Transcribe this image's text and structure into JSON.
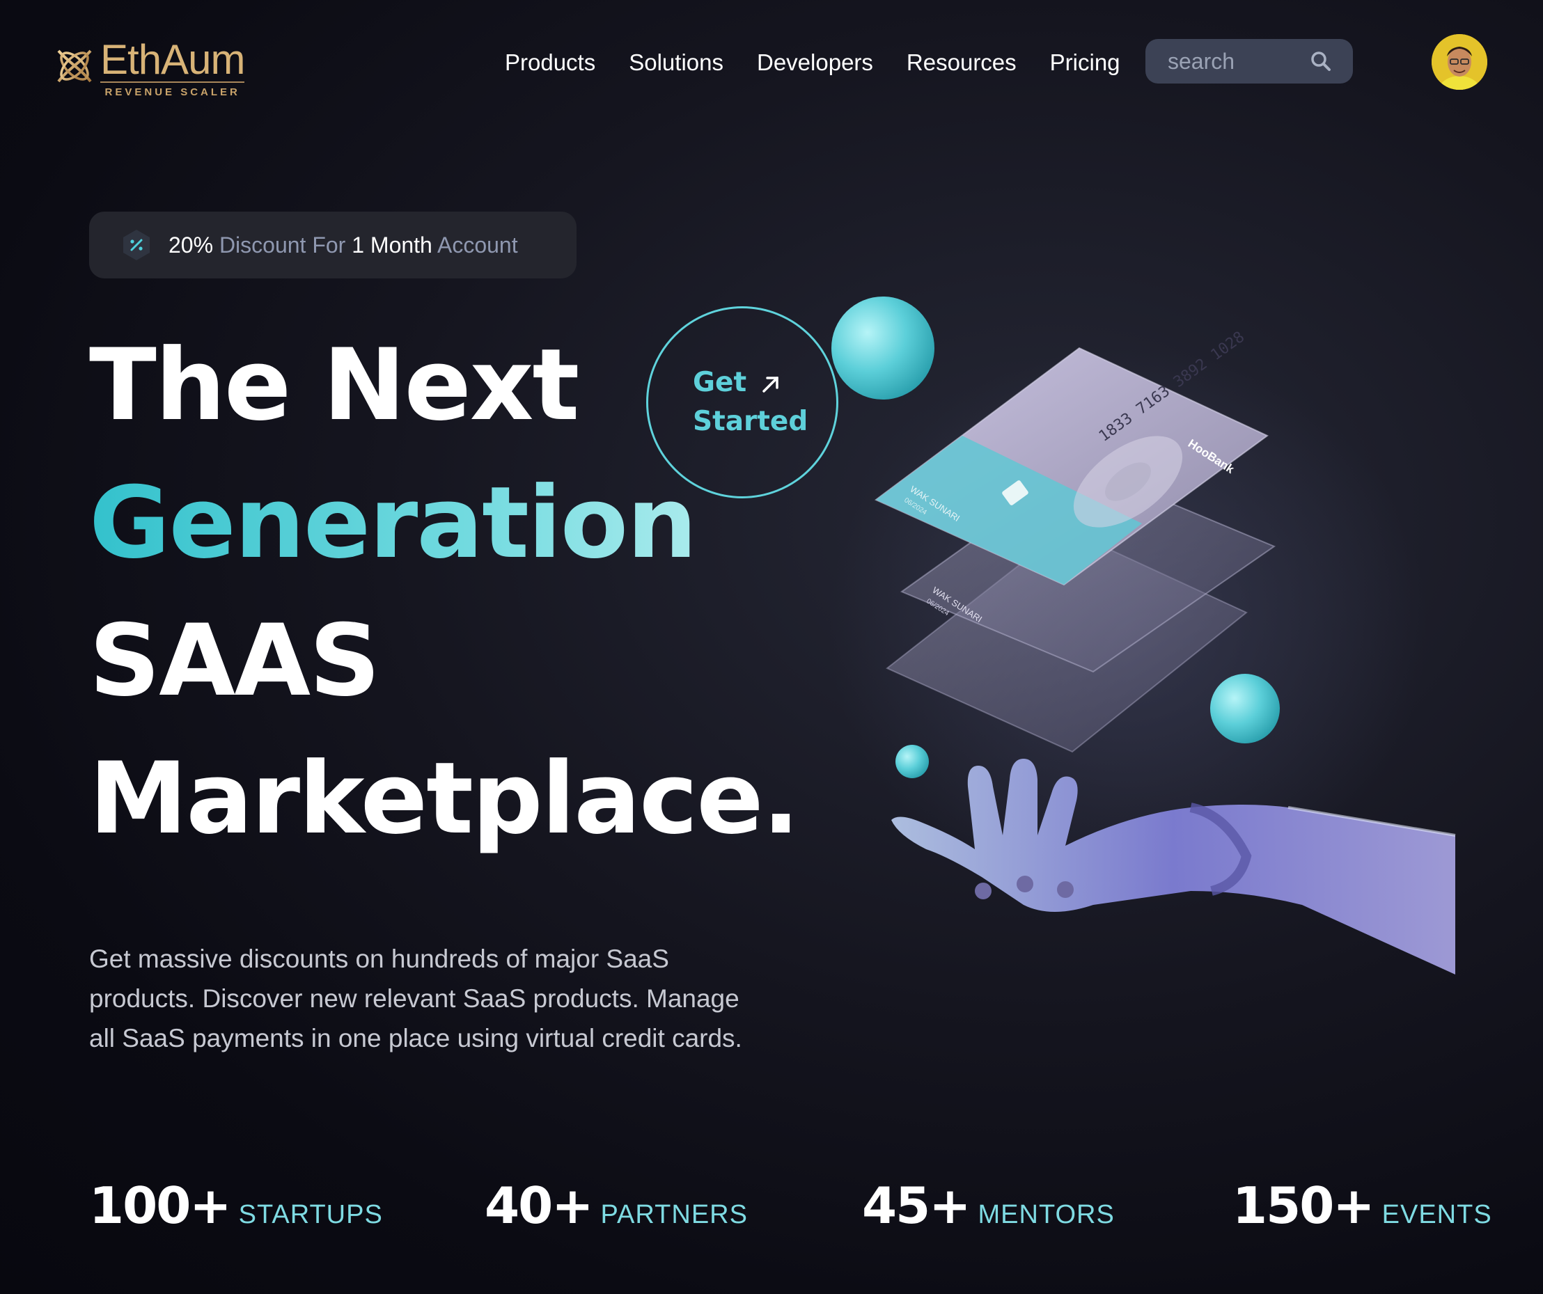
{
  "brand": {
    "name": "EthAum",
    "tagline": "REVENUE SCALER",
    "color": "#d8b377"
  },
  "nav": {
    "items": [
      "Products",
      "Solutions",
      "Developers",
      "Resources",
      "Pricing"
    ]
  },
  "search": {
    "placeholder": "search"
  },
  "badge": {
    "pct": "20%",
    "w1": "Discount For",
    "num": "1",
    "month": "Month",
    "w2": "Account"
  },
  "hero": {
    "line1": "The Next",
    "line2": "Generation",
    "line3": "SAAS",
    "line4": "Marketplace.",
    "description": "Get massive discounts on hundreds of major SaaS products. Discover new relevant SaaS products. Manage all SaaS payments in one place using virtual credit cards."
  },
  "cta": {
    "line1": "Get",
    "line2": "Started"
  },
  "card": {
    "number": "1833 7163 3892 1028",
    "bank": "HooBank",
    "holder": "WAK SUNARI",
    "expiry": "06/2024"
  },
  "stats": [
    {
      "value": "100+",
      "label": "STARTUPS"
    },
    {
      "value": "40+",
      "label": "PARTNERS"
    },
    {
      "value": "45+",
      "label": "MENTORS"
    },
    {
      "value": "150+",
      "label": "EVENTS"
    }
  ],
  "colors": {
    "accent": "#5ed0da",
    "background": "#0f0f17"
  }
}
